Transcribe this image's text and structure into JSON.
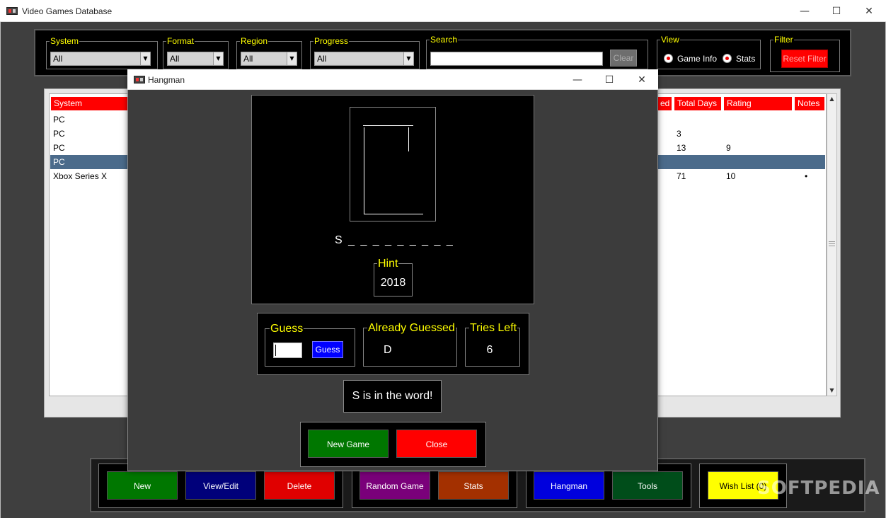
{
  "window": {
    "title": "Video Games Database",
    "minimize": "—",
    "maximize": "☐",
    "close": "✕"
  },
  "filters": {
    "system": {
      "label": "System",
      "value": "All"
    },
    "format": {
      "label": "Format",
      "value": "All"
    },
    "region": {
      "label": "Region",
      "value": "All"
    },
    "progress": {
      "label": "Progress",
      "value": "All"
    },
    "search": {
      "label": "Search",
      "value": "",
      "clear_label": "Clear"
    },
    "view": {
      "label": "View",
      "options": [
        "Game Info",
        "Stats"
      ]
    },
    "filter": {
      "label": "Filter",
      "reset_label": "Reset Filter"
    }
  },
  "table": {
    "columns": [
      "System",
      "ed",
      "Total Days",
      "Rating",
      "Notes"
    ],
    "rows": [
      {
        "system": "PC",
        "total_days": "",
        "rating": "",
        "notes": ""
      },
      {
        "system": "PC",
        "total_days": "3",
        "rating": "",
        "notes": ""
      },
      {
        "system": "PC",
        "total_days": "13",
        "rating": "9",
        "notes": ""
      },
      {
        "system": "PC",
        "total_days": "",
        "rating": "",
        "notes": ""
      },
      {
        "system": "Xbox Series X",
        "total_days": "71",
        "rating": "10",
        "notes": "•"
      }
    ],
    "selected_row_index": 3
  },
  "bottom_buttons": {
    "new": "New",
    "view_edit": "View/Edit",
    "delete": "Delete",
    "random_game": "Random Game",
    "stats": "Stats",
    "hangman": "Hangman",
    "tools": "Tools",
    "wish_list": "Wish List (0)"
  },
  "watermark": "SOFTPEDIA",
  "hangman": {
    "title": "Hangman",
    "word_display": "S _ _ _ _ _ _ _ _ _",
    "hint_label": "Hint",
    "hint_value": "2018",
    "guess_label": "Guess",
    "guess_button": "Guess",
    "guess_value": "",
    "already_guessed_label": "Already Guessed",
    "already_guessed_value": "D",
    "tries_left_label": "Tries Left",
    "tries_left_value": "6",
    "message": "S is in the word!",
    "new_game": "New Game",
    "close": "Close"
  },
  "colors": {
    "accent_yellow": "#ffff00",
    "header_red": "#ff0000",
    "selected_row": "#4b6b8b",
    "btn_green": "#007700",
    "btn_navy": "#00007a",
    "btn_red": "#e00000",
    "btn_purple": "#7a007a",
    "btn_rust": "#a33000",
    "btn_blue": "#0000dd",
    "btn_darkgreen": "#004d1a",
    "btn_yellow": "#ffff00"
  }
}
